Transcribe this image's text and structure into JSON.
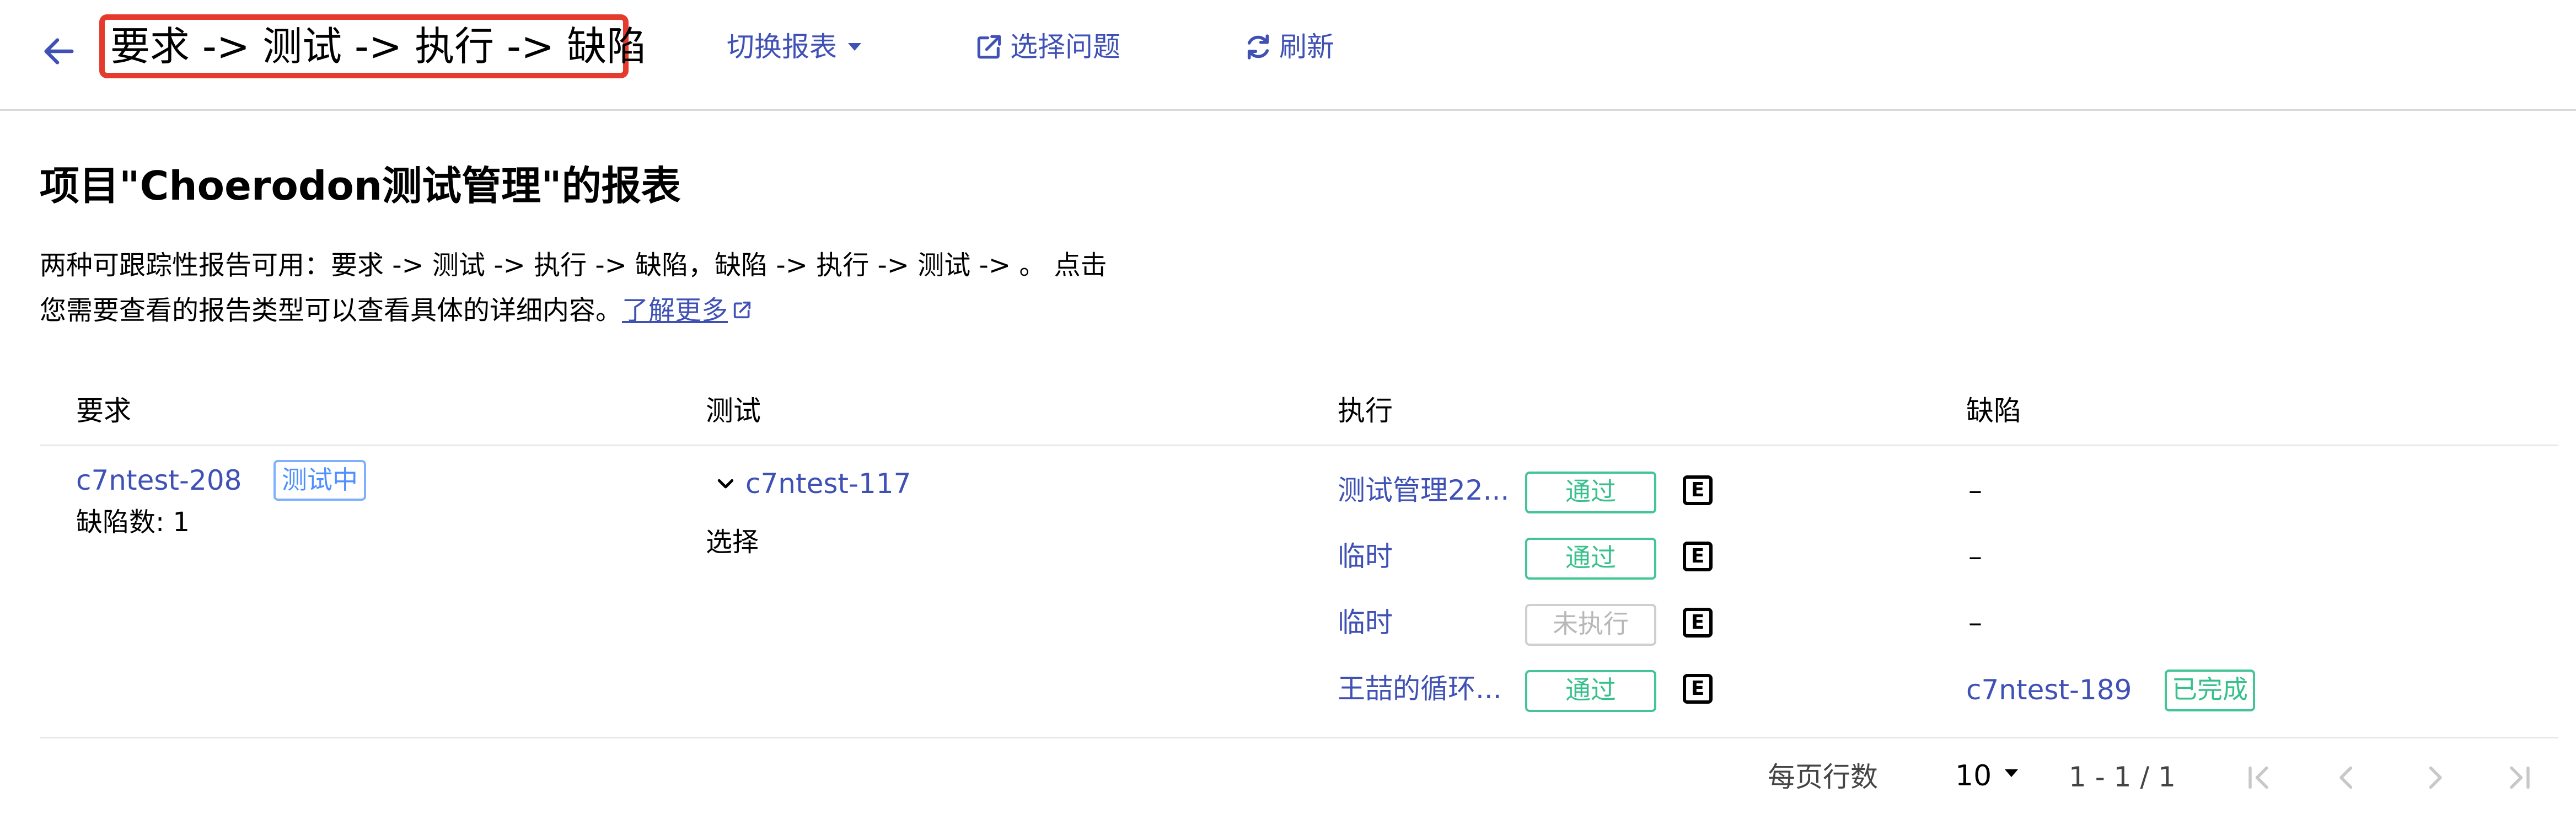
{
  "header": {
    "title": "要求 -> 测试 -> 执行 -> 缺陷",
    "switch_report": "切换报表",
    "select_issue": "选择问题",
    "refresh": "刷新"
  },
  "page": {
    "title": "项目\"Choerodon测试管理\"的报表",
    "desc_line1": "两种可跟踪性报告可用：要求 -> 测试 -> 执行 -> 缺陷，缺陷 -> 执行 -> 测试 -> 。 点击",
    "desc_line2": "您需要查看的报告类型可以查看具体的详细内容。",
    "learn_more": "了解更多"
  },
  "table": {
    "columns": [
      "要求",
      "测试",
      "执行",
      "缺陷"
    ],
    "requirement": {
      "key": "c7ntest-208",
      "status": "测试中",
      "defect_count": "缺陷数: 1"
    },
    "test": {
      "key": "c7ntest-117",
      "select_label": "选择"
    },
    "executions": [
      {
        "name": "测试管理22...",
        "status": "通过",
        "e_label": "E",
        "defect": "–"
      },
      {
        "name": "临时",
        "status": "通过",
        "e_label": "E",
        "defect": "–"
      },
      {
        "name": "临时",
        "status": "未执行",
        "e_label": "E",
        "defect": "–"
      },
      {
        "name": "王喆的循环...",
        "status": "通过",
        "e_label": "E",
        "defect": "c7ntest-189",
        "defect_status": "已完成"
      }
    ]
  },
  "pagination": {
    "rows_per_page_label": "每页行数",
    "rows_per_page": "10",
    "range": "1 - 1 / 1"
  },
  "colors": {
    "accent": "#3f51b5",
    "highlight_border": "#e43b2c",
    "pass_green": "#36c08b",
    "testing_blue": "#4d90fe",
    "not_run_gray": "#b8b8b8"
  }
}
